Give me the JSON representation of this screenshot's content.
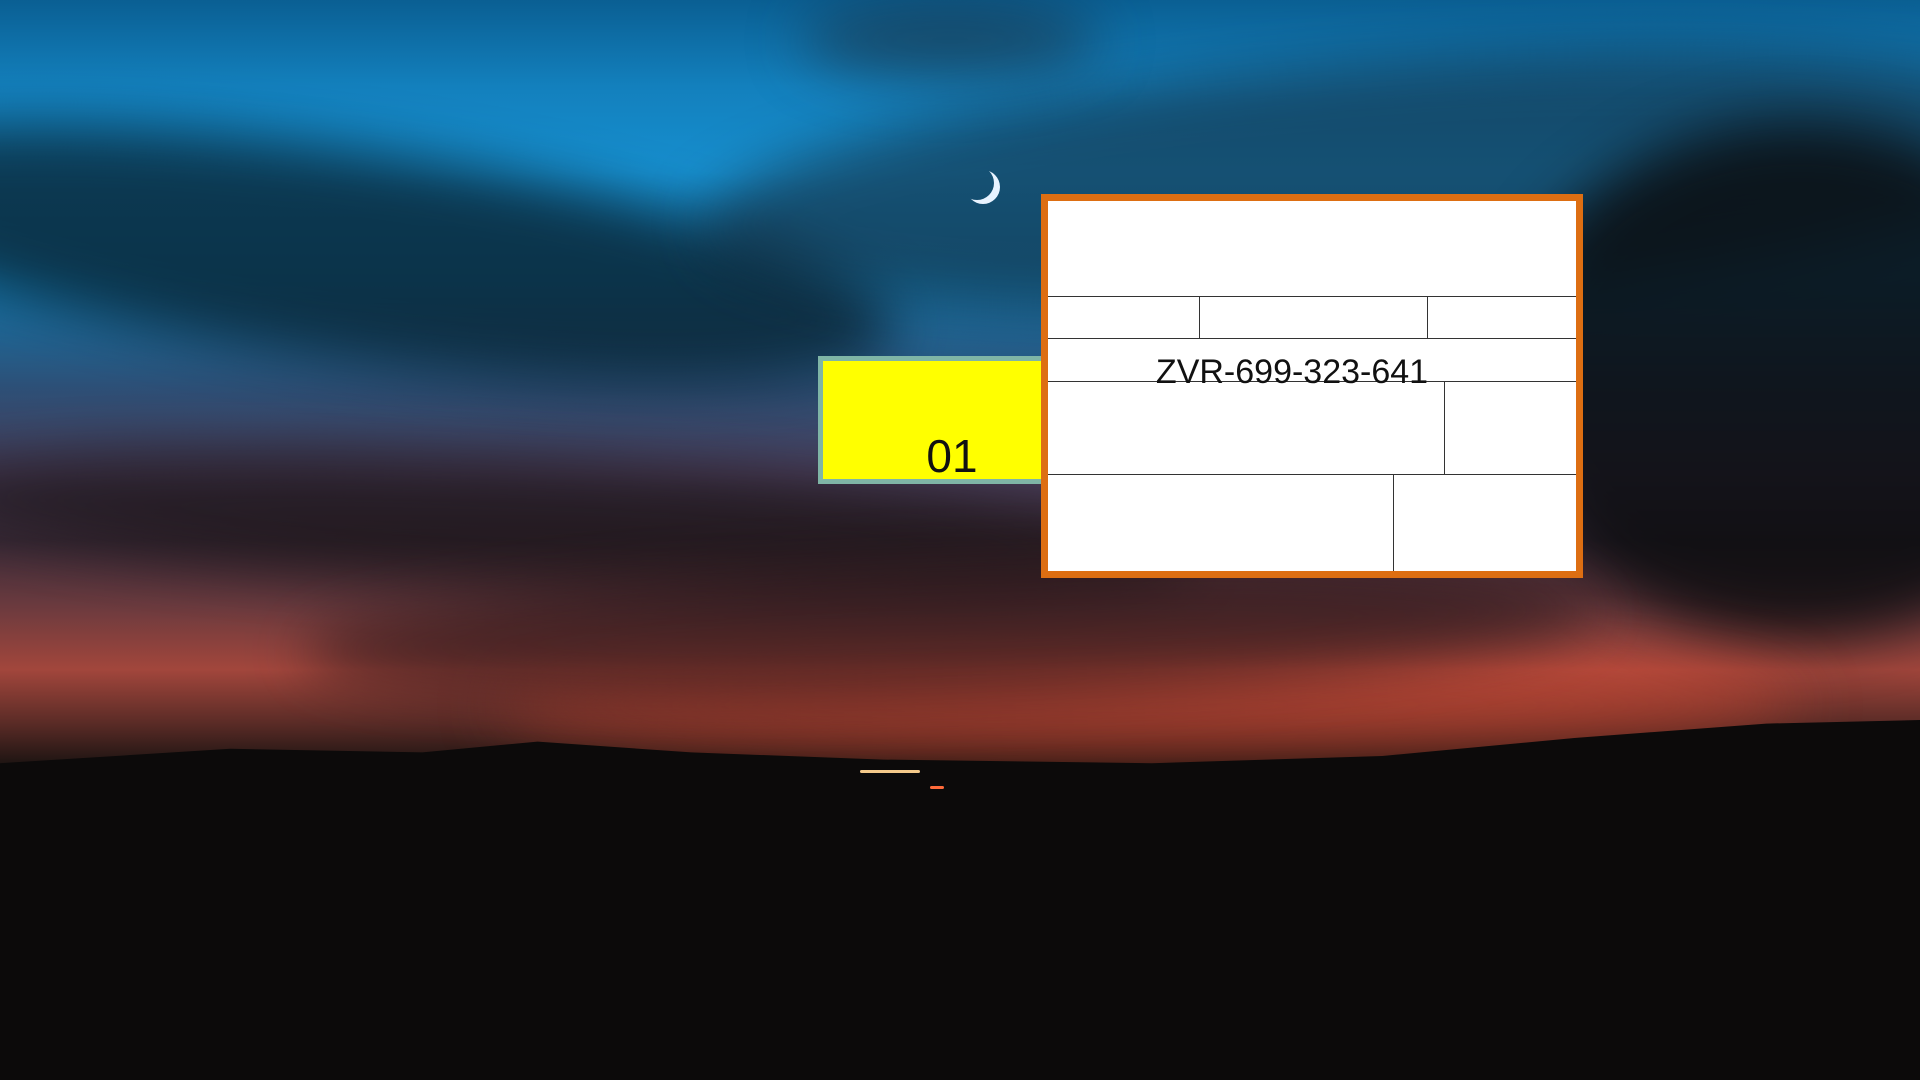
{
  "tag": {
    "number": "01",
    "fill_color": "#ffff00",
    "border_color": "#7fb5a6"
  },
  "card": {
    "id_text": "ZVR-699-323-641",
    "border_color": "#dd6e12"
  }
}
